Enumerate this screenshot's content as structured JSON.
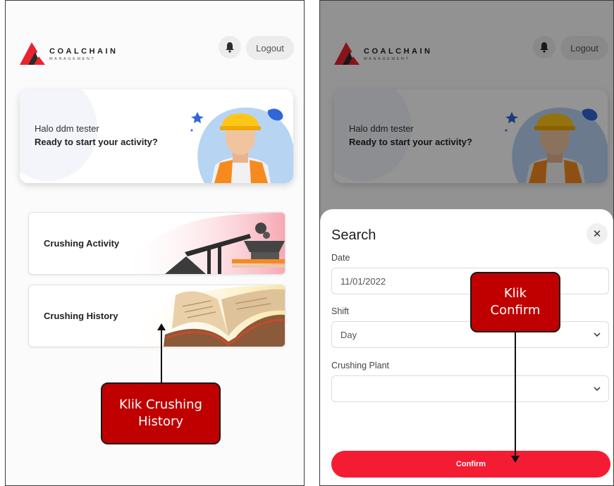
{
  "brand": {
    "name": "COALCHAIN",
    "subtitle": "MANAGEMENT",
    "accent": "#e8242f"
  },
  "header": {
    "logout_label": "Logout",
    "bell_icon": "bell-icon"
  },
  "greeting": {
    "hello": "Halo ddm tester",
    "prompt": "Ready to start your activity?"
  },
  "menu": {
    "items": [
      {
        "label": "Crushing Activity",
        "icon": "crusher-conveyor-illustration"
      },
      {
        "label": "Crushing History",
        "icon": "open-book-illustration"
      }
    ]
  },
  "search_sheet": {
    "title": "Search",
    "close_icon": "close-icon",
    "date_label": "Date",
    "date_value": "11/01/2022",
    "shift_label": "Shift",
    "shift_value": "Day",
    "plant_label": "Crushing Plant",
    "plant_value": "",
    "confirm_label": "Confirm",
    "confirm_color": "#f41c33"
  },
  "annotations": {
    "left": "Klik Crushing History",
    "right": "Klik Confirm",
    "fill": "#c00000"
  }
}
